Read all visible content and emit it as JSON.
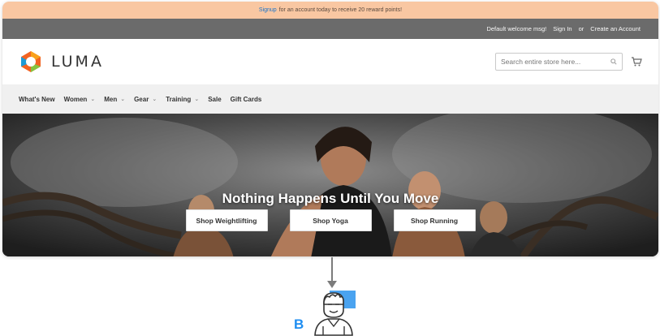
{
  "promo": {
    "link": "Signup",
    "text": "for an account today to receive 20 reward points!"
  },
  "topbar": {
    "welcome": "Default welcome msg!",
    "sign_in": "Sign In",
    "or": "or",
    "create": "Create an Account"
  },
  "header": {
    "logo_text": "LUMA",
    "search_placeholder": "Search entire store here..."
  },
  "nav": {
    "items": [
      {
        "label": "What's New",
        "dropdown": false
      },
      {
        "label": "Women",
        "dropdown": true
      },
      {
        "label": "Men",
        "dropdown": true
      },
      {
        "label": "Gear",
        "dropdown": true
      },
      {
        "label": "Training",
        "dropdown": true
      },
      {
        "label": "Sale",
        "dropdown": false
      },
      {
        "label": "Gift Cards",
        "dropdown": false
      }
    ]
  },
  "hero": {
    "title": "Nothing Happens Until You Move",
    "buttons": [
      "Shop Weightlifting",
      "Shop Yoga",
      "Shop Running"
    ]
  },
  "annotation": {
    "letter": "B"
  },
  "colors": {
    "promo_bg": "#f9c7a2",
    "topbar_bg": "#6b6b6b",
    "link": "#1a73c8",
    "accent": "#1f8ef1"
  }
}
